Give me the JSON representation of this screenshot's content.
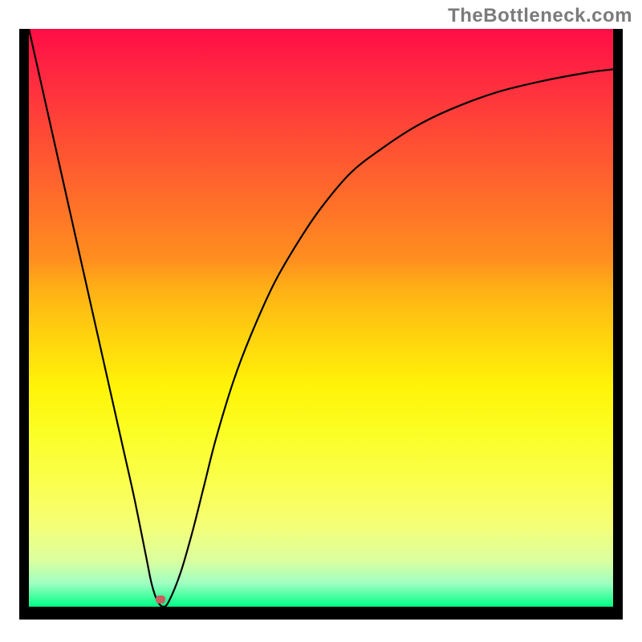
{
  "watermark": "TheBottleneck.com",
  "colors": {
    "frame_bg": "#000000",
    "curve": "#000000",
    "marker": "#c86060",
    "watermark_text": "#7b7b7b"
  },
  "marker": {
    "x_pct": 22.5,
    "y_pct": 99.0
  },
  "chart_data": {
    "type": "line",
    "title": "",
    "xlabel": "",
    "ylabel": "",
    "xlim": [
      0,
      100
    ],
    "ylim": [
      0,
      100
    ],
    "grid": false,
    "legend": false,
    "annotations": [
      "TheBottleneck.com"
    ],
    "background": "heat-gradient (red→yellow→green top→bottom)",
    "series": [
      {
        "name": "bottleneck-curve",
        "x": [
          0,
          2,
          4,
          6,
          8,
          10,
          12,
          14,
          16,
          18,
          20,
          21,
          22,
          23,
          24,
          26,
          28,
          30,
          32,
          35,
          38,
          42,
          46,
          50,
          55,
          60,
          66,
          72,
          80,
          88,
          96,
          100
        ],
        "y": [
          100,
          91,
          82,
          73,
          64,
          55,
          46,
          37,
          28,
          19,
          9,
          4,
          1,
          0,
          1,
          6,
          13,
          21,
          29,
          39,
          47,
          56,
          63,
          69,
          75,
          79,
          83,
          86,
          89,
          91,
          92.5,
          93
        ]
      }
    ],
    "markers": [
      {
        "name": "optimal-point",
        "x": 22.5,
        "y": 0
      }
    ]
  }
}
